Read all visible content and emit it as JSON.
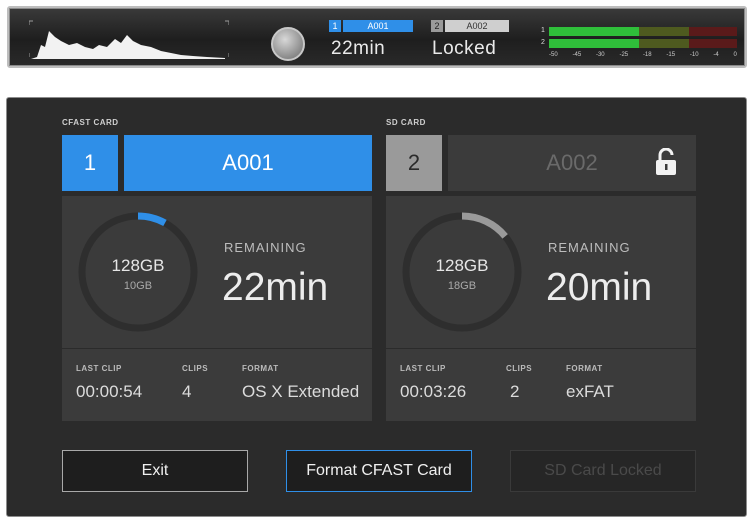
{
  "topbar": {
    "slot1": {
      "number": "1",
      "name": "A001",
      "status": "22min"
    },
    "slot2": {
      "number": "2",
      "name": "A002",
      "status": "Locked"
    },
    "audio": {
      "channels": [
        "1",
        "2"
      ],
      "scale": [
        "-50",
        "-45",
        "-30",
        "-25",
        "-18",
        "-15",
        "-10",
        "-4",
        "0"
      ]
    }
  },
  "cfast": {
    "section_label": "CFAST CARD",
    "slot_number": "1",
    "card_name": "A001",
    "capacity_total": "128GB",
    "capacity_used": "10GB",
    "used_fraction": 0.08,
    "remaining_label": "REMAINING",
    "remaining_value": "22min",
    "last_clip_label": "LAST CLIP",
    "last_clip_value": "00:00:54",
    "clips_label": "CLIPS",
    "clips_value": "4",
    "format_label": "FORMAT",
    "format_value": "OS X Extended",
    "accent": "#2f8fe8"
  },
  "sd": {
    "section_label": "SD CARD",
    "slot_number": "2",
    "card_name": "A002",
    "capacity_total": "128GB",
    "capacity_used": "18GB",
    "used_fraction": 0.14,
    "remaining_label": "REMAINING",
    "remaining_value": "20min",
    "last_clip_label": "LAST CLIP",
    "last_clip_value": "00:03:26",
    "clips_label": "CLIPS",
    "clips_value": "2",
    "format_label": "FORMAT",
    "format_value": "exFAT",
    "lock_icon": "unlock-icon",
    "accent": "#9a9a9a"
  },
  "buttons": {
    "exit": "Exit",
    "format": "Format CFAST Card",
    "sd_locked": "SD Card Locked"
  }
}
